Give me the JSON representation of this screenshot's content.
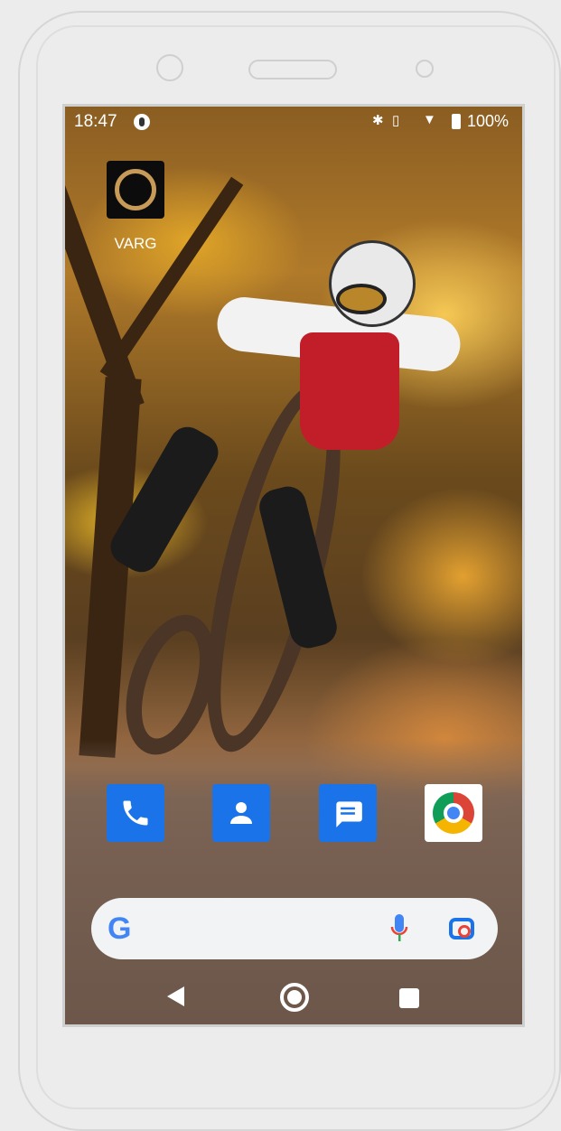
{
  "status_bar": {
    "time": "18:47",
    "battery_percent": "100%",
    "icons": [
      "app-notification-icon",
      "bluetooth-icon",
      "vibrate-icon",
      "wifi-icon",
      "battery-charging-icon"
    ]
  },
  "home": {
    "apps": [
      {
        "label": "VARG",
        "icon": "varg-ring-icon"
      }
    ],
    "dock": [
      {
        "icon": "phone-icon",
        "color": "#1a73e8"
      },
      {
        "icon": "contacts-icon",
        "color": "#1a73e8"
      },
      {
        "icon": "messages-icon",
        "color": "#1a73e8"
      },
      {
        "icon": "chrome-icon",
        "color": "#ffffff"
      }
    ],
    "search": {
      "logo": "G",
      "icons": [
        "google-g-icon",
        "mic-icon",
        "lens-icon"
      ]
    }
  },
  "nav_bar": {
    "icons": [
      "back-icon",
      "home-icon",
      "recents-icon"
    ]
  },
  "wallpaper": {
    "subject": "motocross"
  }
}
